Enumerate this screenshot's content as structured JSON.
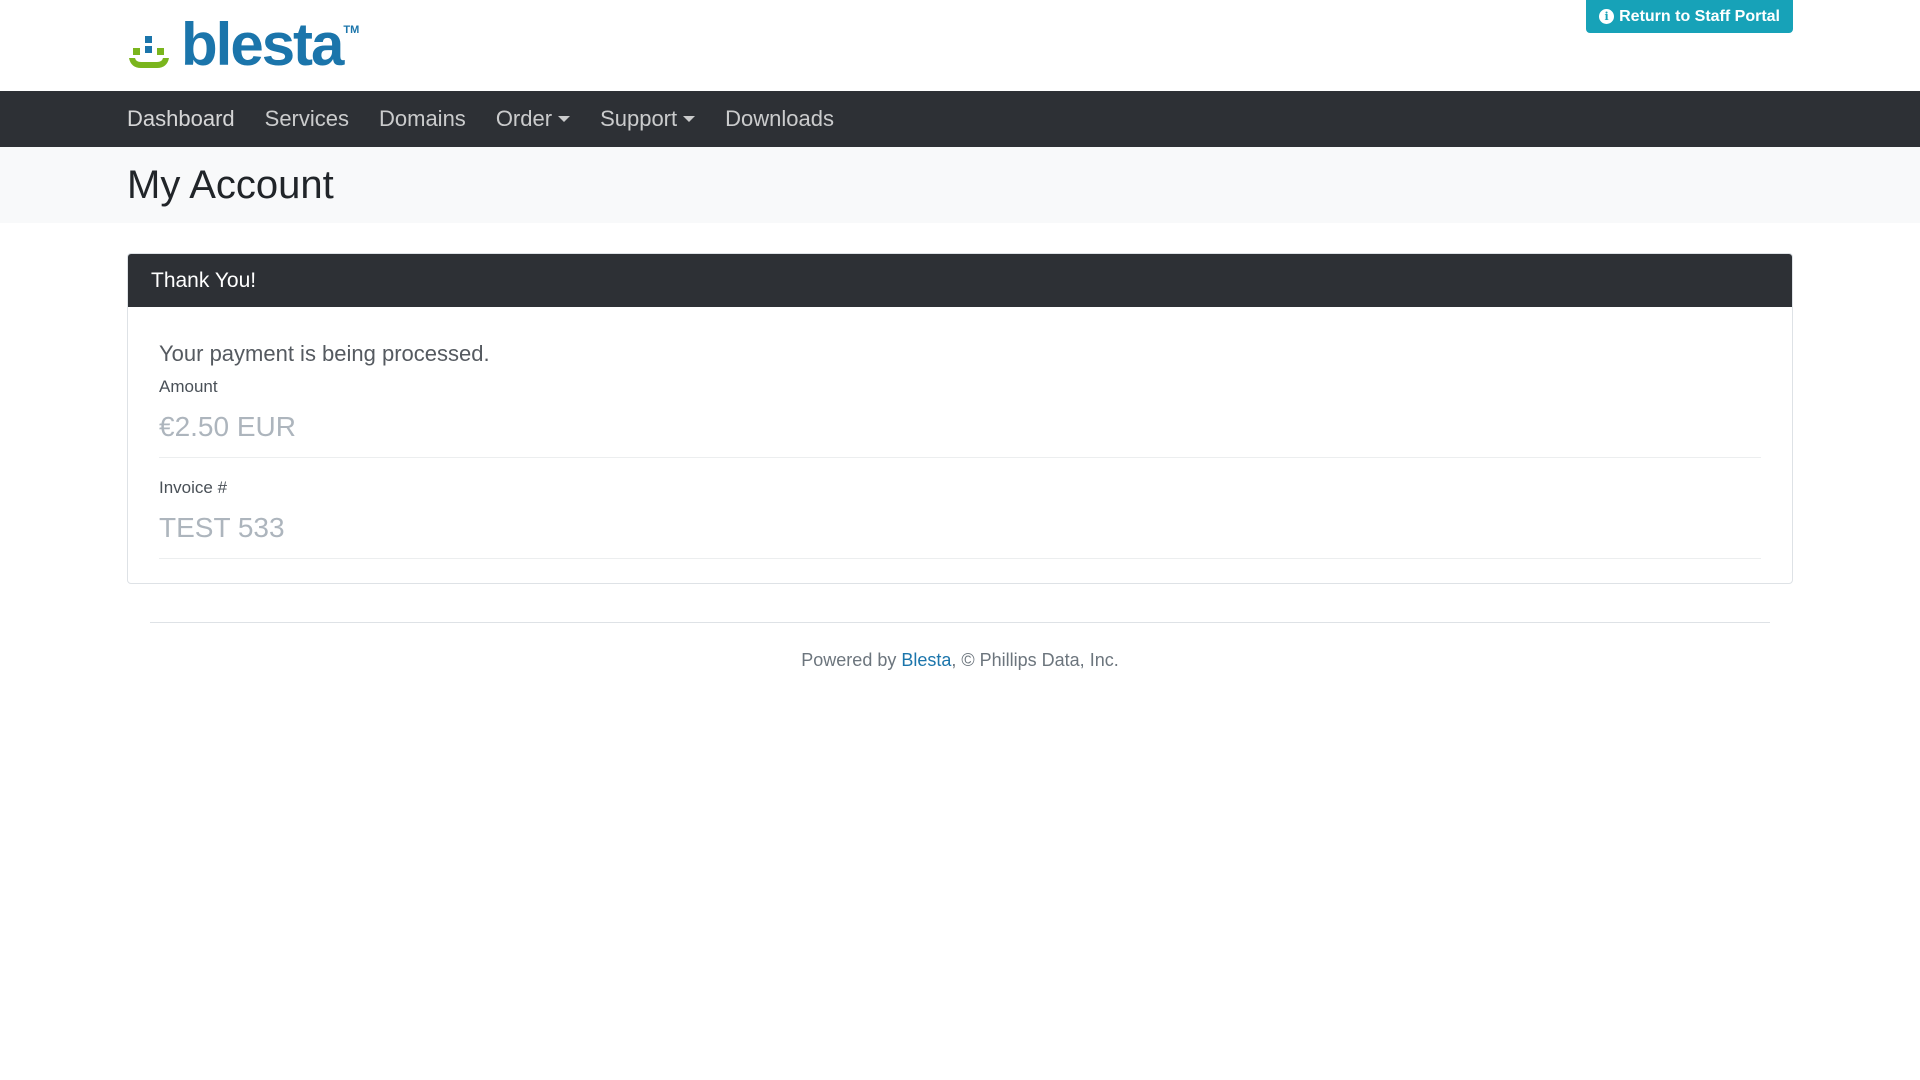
{
  "header": {
    "logo_text": "blesta",
    "logo_tm": "TM",
    "staff_portal_button": "Return to Staff Portal",
    "info_icon_glyph": "i"
  },
  "nav": {
    "items": [
      {
        "label": "Dashboard",
        "dropdown": false
      },
      {
        "label": "Services",
        "dropdown": false
      },
      {
        "label": "Domains",
        "dropdown": false
      },
      {
        "label": "Order",
        "dropdown": true
      },
      {
        "label": "Support",
        "dropdown": true
      },
      {
        "label": "Downloads",
        "dropdown": false
      }
    ]
  },
  "page": {
    "title": "My Account"
  },
  "card": {
    "header": "Thank You!",
    "message": "Your payment is being processed.",
    "amount_label": "Amount",
    "amount_value": "€2.50 EUR",
    "invoice_label": "Invoice #",
    "invoice_value": "TEST 533"
  },
  "footer": {
    "prefix": "Powered by ",
    "link_text": "Blesta",
    "suffix": ", © Phillips Data, Inc."
  },
  "colors": {
    "brand_blue": "#1b75ab",
    "brand_green": "#7ab51d",
    "staff_button": "#17a2b8",
    "navbar": "#2d3035"
  }
}
